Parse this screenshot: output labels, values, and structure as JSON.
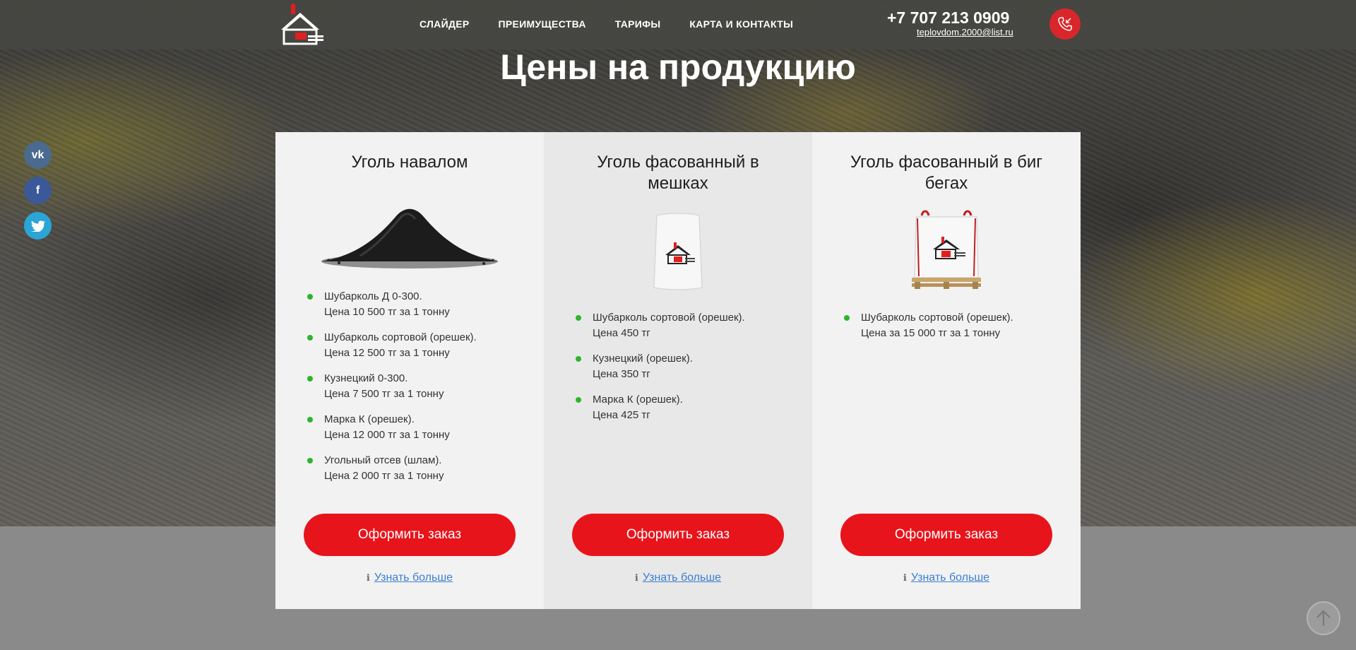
{
  "header": {
    "nav": [
      "СЛАЙДЕР",
      "ПРЕИМУЩЕСТВА",
      "ТАРИФЫ",
      "КАРТА И КОНТАКТЫ"
    ],
    "phone": "+7 707 213 0909",
    "email": "teplovdom.2000@list.ru"
  },
  "social": [
    "vk-icon",
    "facebook-icon",
    "twitter-icon"
  ],
  "title": "Цены на продукцию",
  "cards": [
    {
      "title": "Уголь навалом",
      "items": [
        {
          "name": "Шубарколь Д 0-300.",
          "price": "Цена 10 500 тг за 1 тонну"
        },
        {
          "name": "Шубарколь сортовой (орешек).",
          "price": "Цена 12 500 тг за 1 тонну"
        },
        {
          "name": "Кузнецкий 0-300.",
          "price": "Цена 7 500 тг за 1 тонну"
        },
        {
          "name": "Марка К (орешек).",
          "price": "Цена 12 000 тг за 1 тонну"
        },
        {
          "name": "Угольный отсев (шлам).",
          "price": "Цена 2 000 тг за 1 тонну"
        }
      ],
      "button": "Оформить заказ",
      "more": "Узнать больше"
    },
    {
      "title": "Уголь фасованный в мешках",
      "items": [
        {
          "name": "Шубарколь сортовой (орешек).",
          "price": "Цена 450 тг"
        },
        {
          "name": "Кузнецкий (орешек).",
          "price": "Цена 350 тг"
        },
        {
          "name": "Марка К (орешек).",
          "price": "Цена 425 тг"
        }
      ],
      "button": "Оформить заказ",
      "more": "Узнать больше"
    },
    {
      "title": "Уголь фасованный в биг бегах",
      "items": [
        {
          "name": "Шубарколь сортовой (орешек).",
          "price": "Цена за 15 000 тг за 1 тонну"
        }
      ],
      "button": "Оформить заказ",
      "more": "Узнать больше"
    }
  ],
  "colors": {
    "accent": "#e8141b",
    "bullet": "#2cb52c",
    "link": "#3b7fd2",
    "call": "#d9262b"
  }
}
